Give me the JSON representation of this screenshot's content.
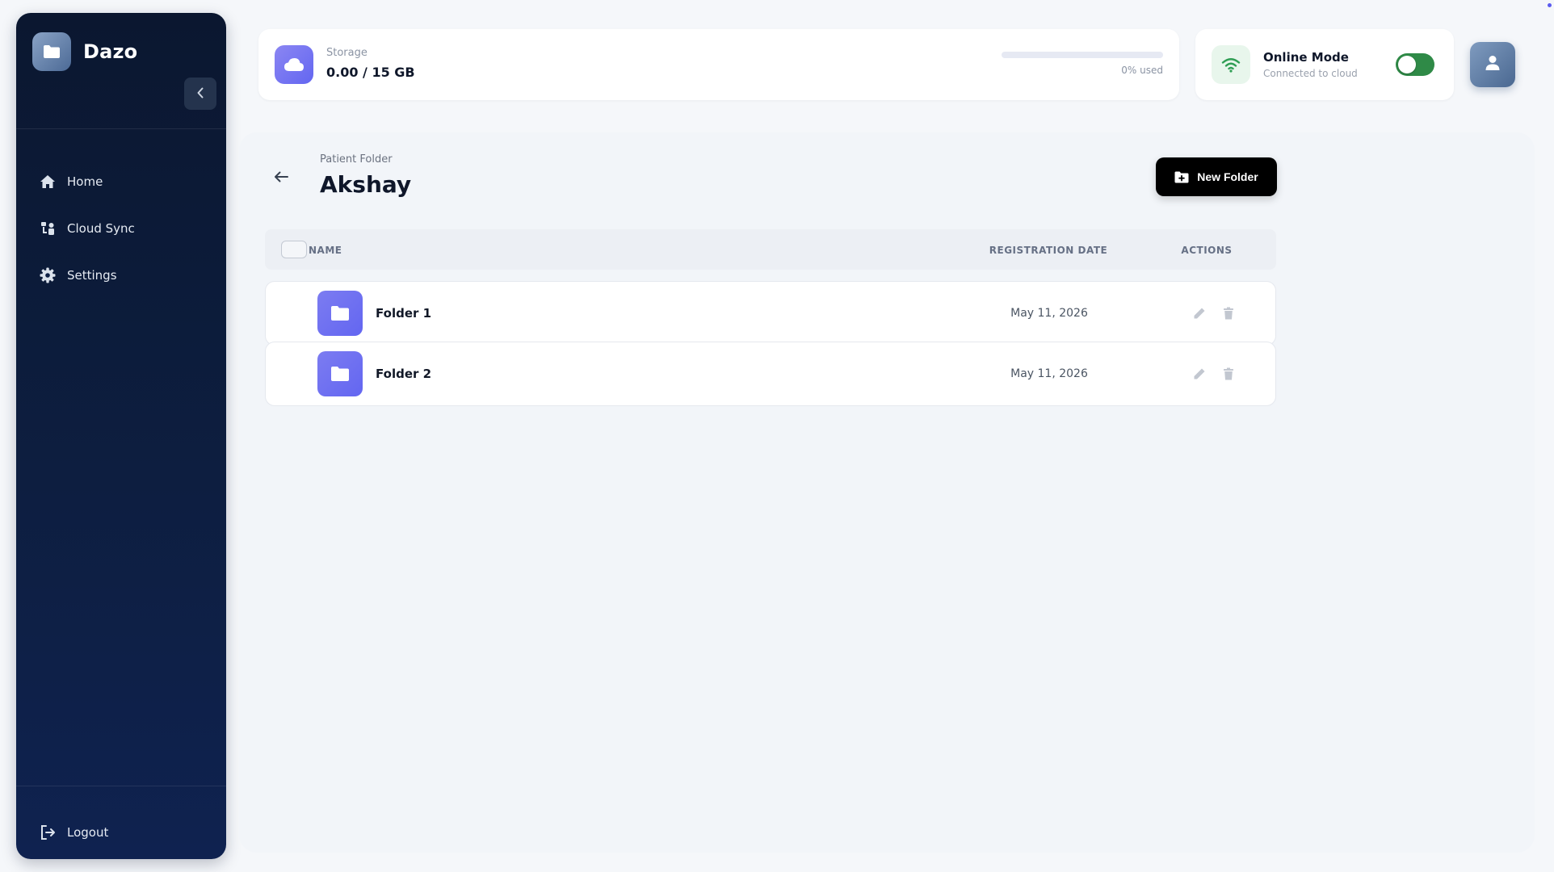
{
  "app": {
    "name": "Dazo"
  },
  "sidebar": {
    "items": [
      {
        "label": "Home",
        "icon": "home-icon"
      },
      {
        "label": "Cloud Sync",
        "icon": "cloud-sync-icon"
      },
      {
        "label": "Settings",
        "icon": "gear-icon"
      }
    ],
    "logout_label": "Logout"
  },
  "storage": {
    "label": "Storage",
    "value": "0.00 / 15 GB",
    "used_fraction": 0.0,
    "used_text": "0% used"
  },
  "connection": {
    "title": "Online Mode",
    "subtitle": "Connected to cloud",
    "enabled": true
  },
  "main": {
    "breadcrumb": "Patient Folder",
    "title": "Akshay",
    "new_folder_label": "New Folder",
    "table": {
      "columns": [
        "NAME",
        "REGISTRATION DATE",
        "ACTIONS"
      ],
      "rows": [
        {
          "name": "Folder 1",
          "date": "May 11, 2026"
        },
        {
          "name": "Folder 2",
          "date": "May 11, 2026"
        }
      ]
    }
  },
  "colors": {
    "sidebar_bg": "#0d1e40",
    "accent": "#6366f1",
    "toggle_on": "#2f8a47",
    "wifi_green": "#2f9e54",
    "primary_button": "#000000"
  }
}
